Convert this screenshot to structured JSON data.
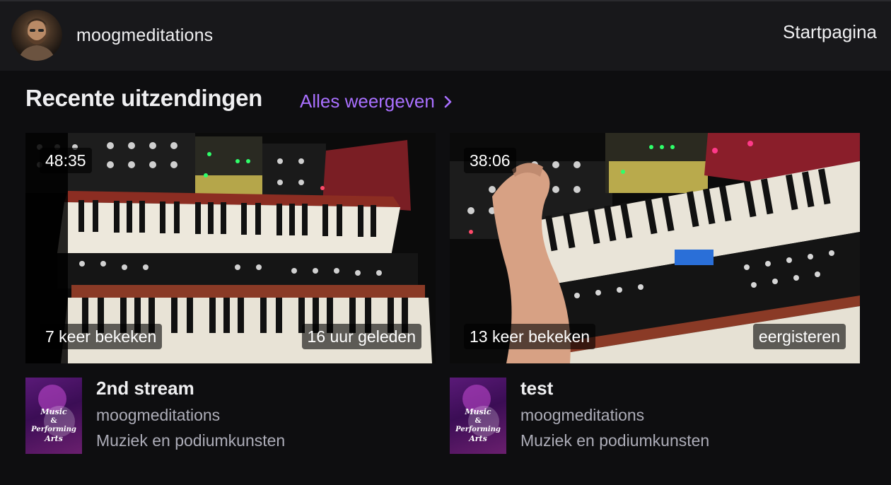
{
  "header": {
    "channel_name": "moogmeditations",
    "home_link": "Startpagina"
  },
  "section": {
    "title": "Recente uitzendingen",
    "view_all": "Alles weergeven"
  },
  "videos": [
    {
      "duration": "48:35",
      "views": "7 keer bekeken",
      "age": "16 uur geleden",
      "title": "2nd stream",
      "channel": "moogmeditations",
      "category": "Muziek en podiumkunsten",
      "category_art_text": "Music & Performing Arts"
    },
    {
      "duration": "38:06",
      "views": "13 keer bekeken",
      "age": "eergisteren",
      "title": "test",
      "channel": "moogmeditations",
      "category": "Muziek en podiumkunsten",
      "category_art_text": "Music & Performing Arts"
    }
  ],
  "colors": {
    "accent": "#a970ff",
    "background": "#0e0e10",
    "topbar": "#18181b",
    "muted_text": "#adadb8"
  }
}
